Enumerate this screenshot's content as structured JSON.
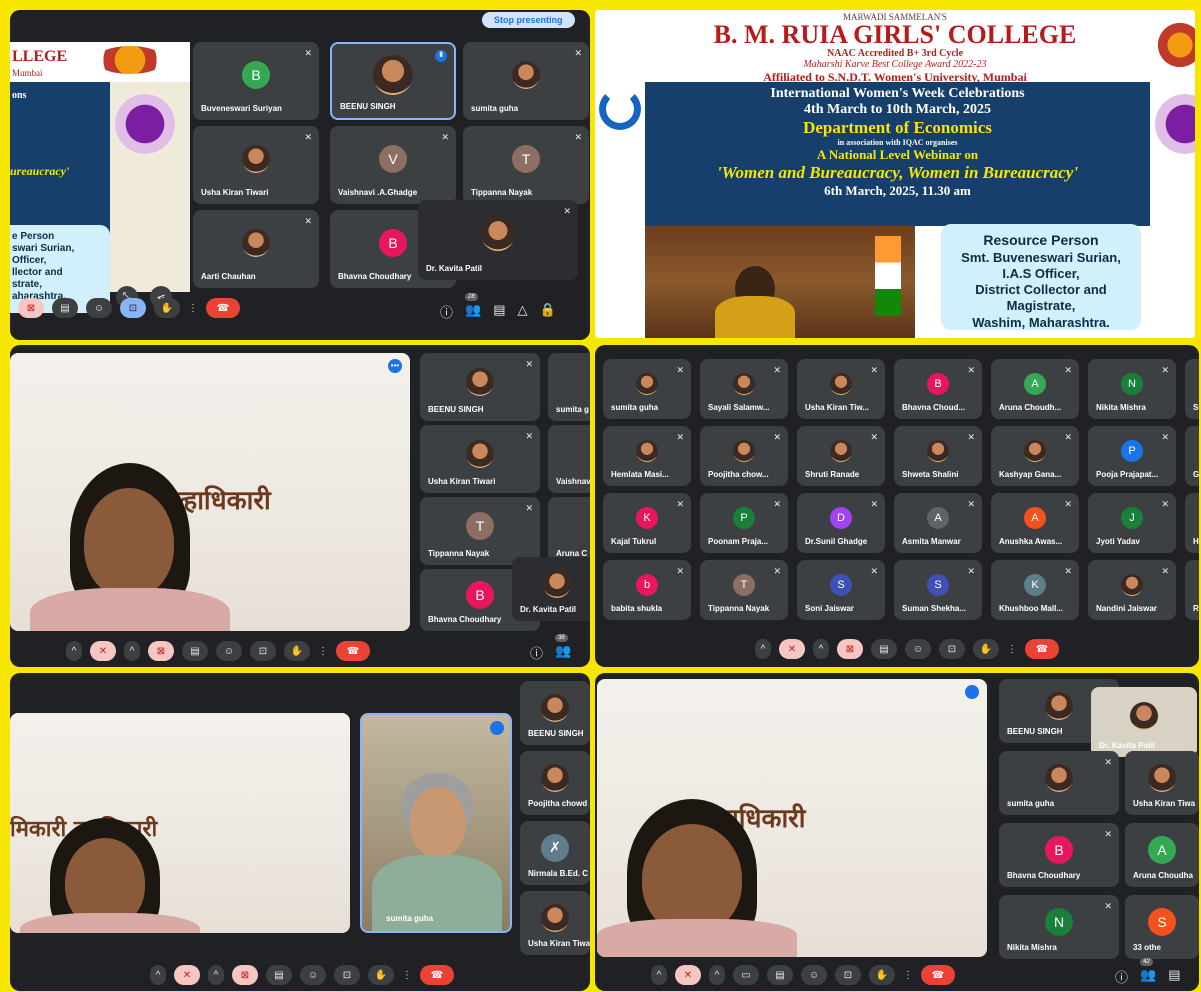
{
  "panel1": {
    "stop_presenting": "Stop presenting",
    "slide_fragments": [
      "LLEGE",
      "Mumbai",
      "ons",
      "ureaucracy'",
      "e Person",
      "swari Surian,",
      "Officer,",
      "llector and",
      "strate,",
      "aharashtra."
    ],
    "tiles": [
      {
        "name": "Buveneswari Suriyan",
        "avatar": "B",
        "color": "#34a853"
      },
      {
        "name": "BEENU SINGH",
        "avatar": "",
        "color": ""
      },
      {
        "name": "sumita guha",
        "avatar": "",
        "color": ""
      },
      {
        "name": "Usha Kiran Tiwari",
        "avatar": "",
        "color": ""
      },
      {
        "name": "Vaishnavi .A.Ghadge",
        "avatar": "V",
        "color": "#8d6e63"
      },
      {
        "name": "Tippanna Nayak",
        "avatar": "T",
        "color": "#8d6e63"
      },
      {
        "name": "Aarti Chauhan",
        "avatar": "",
        "color": ""
      },
      {
        "name": "Bhavna Choudhary",
        "avatar": "B",
        "color": "#e8175d"
      },
      {
        "name": "Dr. Kavita Patil",
        "avatar": "",
        "color": ""
      }
    ],
    "participant_count": "28"
  },
  "slide": {
    "line1": "MARWADI SAMMELAN'S",
    "college": "B. M. RUIA GIRLS' COLLEGE",
    "naac": "NAAC Accredited B+ 3rd Cycle",
    "award": "Maharshi Karve Best College Award 2022-23",
    "affil": "Affiliated to S.N.D.T. Women's University, Mumbai",
    "event": "International Women's Week Celebrations",
    "dates": "4th March to 10th March, 2025",
    "dept": "Department of Economics",
    "assoc": "in association with IQAC organises",
    "webinar": "A National Level Webinar on",
    "topic": "'Women and Bureaucracy, Women in Bureaucracy'",
    "when": "6th March, 2025, 11.30 am",
    "rp_title": "Resource Person",
    "rp_name": "Smt. Buveneswari Surian,",
    "rp_l2": "I.A.S Officer,",
    "rp_l3": "District Collector and",
    "rp_l4": "Magistrate,",
    "rp_l5": "Washim, Maharashtra."
  },
  "panel3": {
    "sign": "ाल्हाधिकारी",
    "tiles": [
      "BEENU SINGH",
      "sumita g",
      "Usha Kiran Tiwari",
      "Vaishnav",
      "Tippanna Nayak",
      "Aruna C",
      "Bhavna Choudhary",
      "Dr. Kavita Patil"
    ],
    "participant_count": "36"
  },
  "panel4": {
    "grid": [
      [
        "sumita guha",
        "Sayali Salamw...",
        "Usha Kiran Tiw...",
        "Bhavna Choud...",
        "Aruna Choudh...",
        "Nikita Mishra",
        "Suna"
      ],
      [
        "Hemlata Masi...",
        "Poojitha chow...",
        "Shruti Ranade",
        "Shweta Shalini",
        "Kashyap Gana...",
        "Pooja Prajapat...",
        "Gau"
      ],
      [
        "Kajal Tukrul",
        "Poonam Praja...",
        "Dr.Sunil Ghadge",
        "Asmita Manwar",
        "Anushka Awas...",
        "Jyoti Yadav",
        "Hind"
      ],
      [
        "babita shukla",
        "Tippanna Nayak",
        "Soni Jaiswar",
        "Suman Shekha...",
        "Khushboo Mall...",
        "Nandini Jaiswar",
        "Run"
      ]
    ],
    "avatars": [
      [
        "",
        "",
        "",
        "B",
        "A",
        "N",
        ""
      ],
      [
        "",
        "",
        "",
        "",
        "",
        "P",
        ""
      ],
      [
        "K",
        "P",
        "D",
        "A",
        "A",
        "J",
        ""
      ],
      [
        "b",
        "T",
        "S",
        "S",
        "K",
        "",
        ""
      ]
    ],
    "colors": [
      [
        "",
        "",
        "",
        "#e8175d",
        "#34a853",
        "#188038",
        ""
      ],
      [
        "",
        "",
        "",
        "",
        "",
        "#1a73e8",
        ""
      ],
      [
        "#e8175d",
        "#188038",
        "#a142f4",
        "#5f6368",
        "#f4511e",
        "#188038",
        ""
      ],
      [
        "#e8175d",
        "#8d6e63",
        "#3f51b5",
        "#3f51b5",
        "#607d8b",
        "",
        ""
      ]
    ]
  },
  "panel5": {
    "sign": "मिकारी   ल्हाधिकारी",
    "pip_name": "sumita guha",
    "tiles": [
      "BEENU SINGH",
      "Poojitha chowd",
      "Nirmala B.Ed. C",
      "Usha Kiran Tiwa"
    ]
  },
  "panel6": {
    "sign": "ल्हाधिकारी",
    "tiles": [
      "BEENU SINGH",
      "Dr. Kavita Patil",
      "sumita guha",
      "Usha Kiran Tiwa",
      "Bhavna Choudhary",
      "Aruna Choudha",
      "Nikita Mishra",
      "33 othe"
    ],
    "participant_count": "42"
  }
}
